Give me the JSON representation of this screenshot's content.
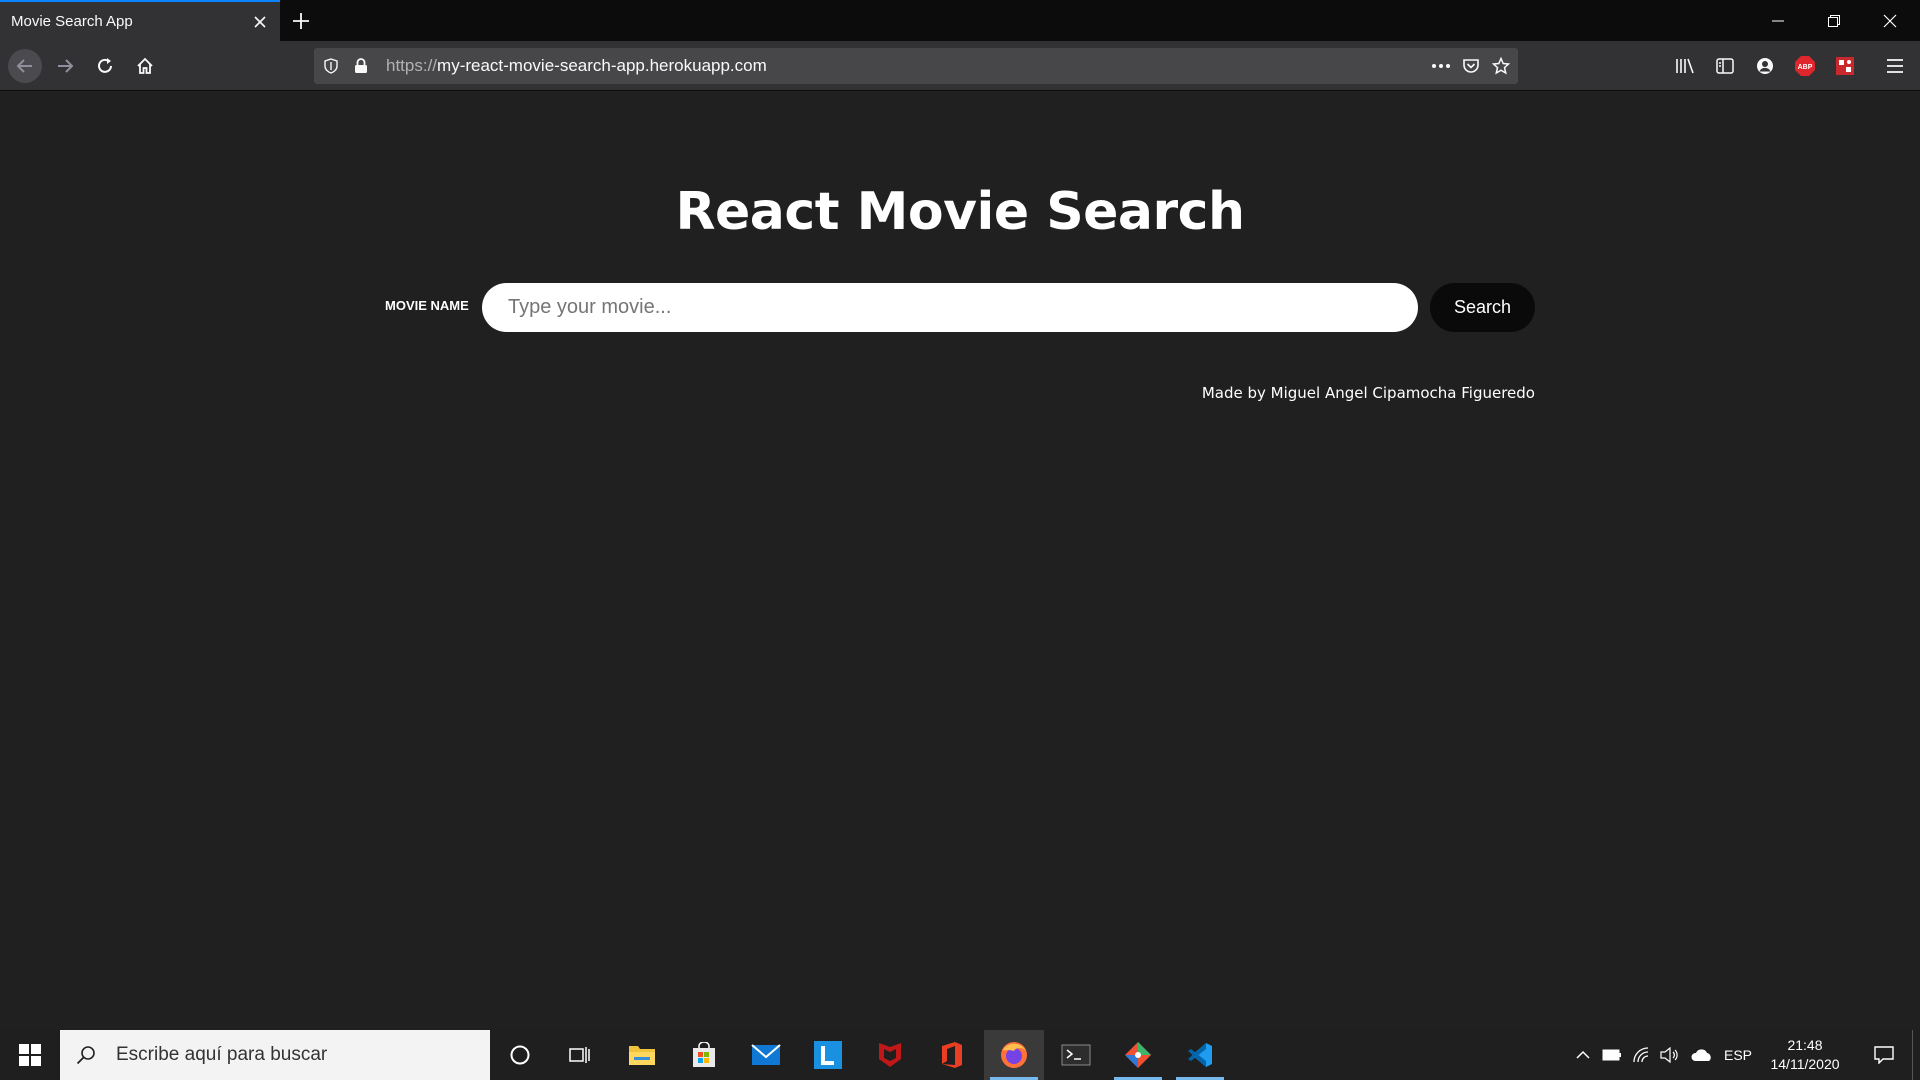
{
  "browser": {
    "tab_title": "Movie Search App",
    "url_protocol": "https://",
    "url_host": "my-react-movie-search-app.herokuapp.com"
  },
  "page": {
    "title": "React Movie Search",
    "search_label": "MOVIE NAME",
    "search_placeholder": "Type your movie...",
    "search_button": "Search",
    "credit": "Made by Miguel Angel Cipamocha Figueredo"
  },
  "taskbar": {
    "search_placeholder": "Escribe aquí para buscar",
    "language": "ESP",
    "time": "21:48",
    "date": "14/11/2020",
    "apps": [
      "cortana-icon",
      "task-view-icon",
      "file-explorer-icon",
      "store-icon",
      "mail-icon",
      "lens-icon",
      "mcafee-icon",
      "office-icon",
      "firefox-icon",
      "terminal-icon",
      "git-icon",
      "vscode-icon"
    ]
  },
  "colors": {
    "page_bg": "#202020",
    "chrome_bg": "#323234",
    "accent": "#0a84ff",
    "search_button_bg": "#0a0a0a"
  }
}
